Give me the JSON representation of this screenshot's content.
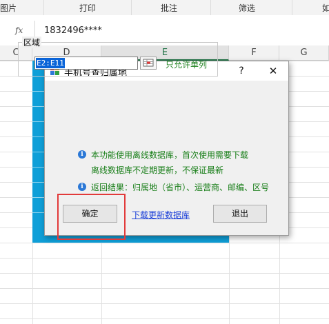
{
  "ribbon": {
    "tabs": [
      "图片",
      "打印",
      "批注",
      "筛选",
      "如"
    ]
  },
  "formula_bar": {
    "fx_label": "fx",
    "value": "1832496****"
  },
  "columns": [
    "C",
    "D",
    "E",
    "F",
    "G"
  ],
  "selected_column": "E",
  "dialog": {
    "title": "手机号查归属地",
    "help_label": "?",
    "close_label": "✕",
    "group_label": "区域",
    "range_value": "E2:E11",
    "only_single_column": "只允许单列",
    "info_lines": [
      "本功能使用离线数据库，首次使用需要下载",
      "离线数据库不定期更新，不保证最新",
      "返回结果：归属地（省市）、运营商、邮编、区号"
    ],
    "ok_label": "确定",
    "download_link": "下载更新数据库",
    "exit_label": "退出"
  },
  "colors": {
    "accent_blue": "#0f9fd8",
    "highlight_red": "#e23a3a",
    "info_green": "#1a7f1a",
    "link_blue": "#1b3fd8"
  }
}
